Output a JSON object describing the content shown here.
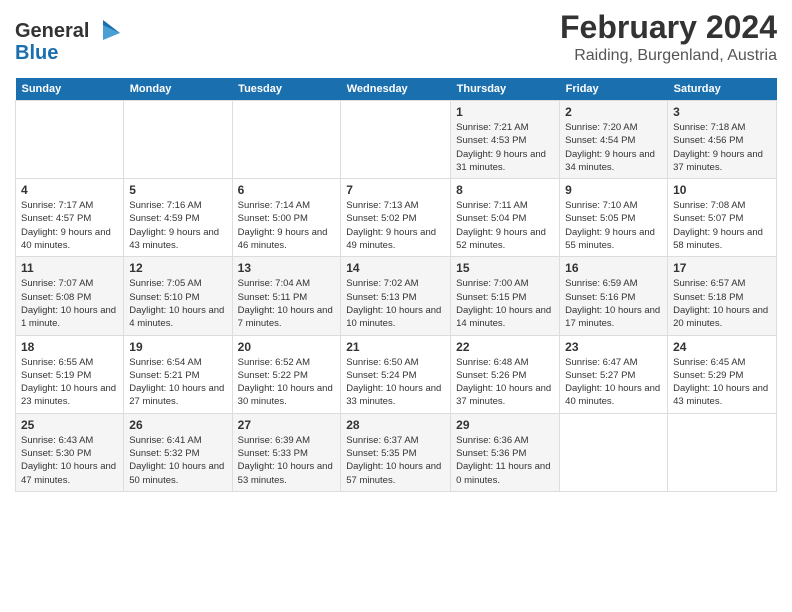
{
  "header": {
    "logo_line1": "General",
    "logo_line2": "Blue",
    "month_year": "February 2024",
    "location": "Raiding, Burgenland, Austria"
  },
  "days_of_week": [
    "Sunday",
    "Monday",
    "Tuesday",
    "Wednesday",
    "Thursday",
    "Friday",
    "Saturday"
  ],
  "weeks": [
    [
      {
        "day": "",
        "info": ""
      },
      {
        "day": "",
        "info": ""
      },
      {
        "day": "",
        "info": ""
      },
      {
        "day": "",
        "info": ""
      },
      {
        "day": "1",
        "info": "Sunrise: 7:21 AM\nSunset: 4:53 PM\nDaylight: 9 hours\nand 31 minutes."
      },
      {
        "day": "2",
        "info": "Sunrise: 7:20 AM\nSunset: 4:54 PM\nDaylight: 9 hours\nand 34 minutes."
      },
      {
        "day": "3",
        "info": "Sunrise: 7:18 AM\nSunset: 4:56 PM\nDaylight: 9 hours\nand 37 minutes."
      }
    ],
    [
      {
        "day": "4",
        "info": "Sunrise: 7:17 AM\nSunset: 4:57 PM\nDaylight: 9 hours\nand 40 minutes."
      },
      {
        "day": "5",
        "info": "Sunrise: 7:16 AM\nSunset: 4:59 PM\nDaylight: 9 hours\nand 43 minutes."
      },
      {
        "day": "6",
        "info": "Sunrise: 7:14 AM\nSunset: 5:00 PM\nDaylight: 9 hours\nand 46 minutes."
      },
      {
        "day": "7",
        "info": "Sunrise: 7:13 AM\nSunset: 5:02 PM\nDaylight: 9 hours\nand 49 minutes."
      },
      {
        "day": "8",
        "info": "Sunrise: 7:11 AM\nSunset: 5:04 PM\nDaylight: 9 hours\nand 52 minutes."
      },
      {
        "day": "9",
        "info": "Sunrise: 7:10 AM\nSunset: 5:05 PM\nDaylight: 9 hours\nand 55 minutes."
      },
      {
        "day": "10",
        "info": "Sunrise: 7:08 AM\nSunset: 5:07 PM\nDaylight: 9 hours\nand 58 minutes."
      }
    ],
    [
      {
        "day": "11",
        "info": "Sunrise: 7:07 AM\nSunset: 5:08 PM\nDaylight: 10 hours\nand 1 minute."
      },
      {
        "day": "12",
        "info": "Sunrise: 7:05 AM\nSunset: 5:10 PM\nDaylight: 10 hours\nand 4 minutes."
      },
      {
        "day": "13",
        "info": "Sunrise: 7:04 AM\nSunset: 5:11 PM\nDaylight: 10 hours\nand 7 minutes."
      },
      {
        "day": "14",
        "info": "Sunrise: 7:02 AM\nSunset: 5:13 PM\nDaylight: 10 hours\nand 10 minutes."
      },
      {
        "day": "15",
        "info": "Sunrise: 7:00 AM\nSunset: 5:15 PM\nDaylight: 10 hours\nand 14 minutes."
      },
      {
        "day": "16",
        "info": "Sunrise: 6:59 AM\nSunset: 5:16 PM\nDaylight: 10 hours\nand 17 minutes."
      },
      {
        "day": "17",
        "info": "Sunrise: 6:57 AM\nSunset: 5:18 PM\nDaylight: 10 hours\nand 20 minutes."
      }
    ],
    [
      {
        "day": "18",
        "info": "Sunrise: 6:55 AM\nSunset: 5:19 PM\nDaylight: 10 hours\nand 23 minutes."
      },
      {
        "day": "19",
        "info": "Sunrise: 6:54 AM\nSunset: 5:21 PM\nDaylight: 10 hours\nand 27 minutes."
      },
      {
        "day": "20",
        "info": "Sunrise: 6:52 AM\nSunset: 5:22 PM\nDaylight: 10 hours\nand 30 minutes."
      },
      {
        "day": "21",
        "info": "Sunrise: 6:50 AM\nSunset: 5:24 PM\nDaylight: 10 hours\nand 33 minutes."
      },
      {
        "day": "22",
        "info": "Sunrise: 6:48 AM\nSunset: 5:26 PM\nDaylight: 10 hours\nand 37 minutes."
      },
      {
        "day": "23",
        "info": "Sunrise: 6:47 AM\nSunset: 5:27 PM\nDaylight: 10 hours\nand 40 minutes."
      },
      {
        "day": "24",
        "info": "Sunrise: 6:45 AM\nSunset: 5:29 PM\nDaylight: 10 hours\nand 43 minutes."
      }
    ],
    [
      {
        "day": "25",
        "info": "Sunrise: 6:43 AM\nSunset: 5:30 PM\nDaylight: 10 hours\nand 47 minutes."
      },
      {
        "day": "26",
        "info": "Sunrise: 6:41 AM\nSunset: 5:32 PM\nDaylight: 10 hours\nand 50 minutes."
      },
      {
        "day": "27",
        "info": "Sunrise: 6:39 AM\nSunset: 5:33 PM\nDaylight: 10 hours\nand 53 minutes."
      },
      {
        "day": "28",
        "info": "Sunrise: 6:37 AM\nSunset: 5:35 PM\nDaylight: 10 hours\nand 57 minutes."
      },
      {
        "day": "29",
        "info": "Sunrise: 6:36 AM\nSunset: 5:36 PM\nDaylight: 11 hours\nand 0 minutes."
      },
      {
        "day": "",
        "info": ""
      },
      {
        "day": "",
        "info": ""
      }
    ]
  ]
}
